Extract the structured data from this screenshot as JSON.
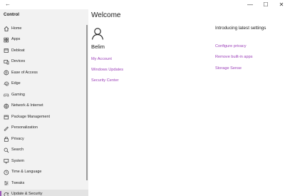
{
  "window": {
    "back_glyph": "←",
    "minimize_glyph": "—",
    "maximize_glyph": "☐",
    "close_glyph": "✕"
  },
  "sidebar": {
    "title": "Control",
    "items": [
      {
        "label": "Home",
        "icon": "home-icon"
      },
      {
        "label": "Apps",
        "icon": "apps-icon"
      },
      {
        "label": "Debloat",
        "icon": "debloat-icon"
      },
      {
        "label": "Devices",
        "icon": "devices-icon"
      },
      {
        "label": "Ease of Access",
        "icon": "ease-of-access-icon"
      },
      {
        "label": "Edge",
        "icon": "edge-icon"
      },
      {
        "label": "Gaming",
        "icon": "gaming-icon"
      },
      {
        "label": "Network & Internet",
        "icon": "network-icon"
      },
      {
        "label": "Package Management",
        "icon": "package-icon"
      },
      {
        "label": "Personalization",
        "icon": "personalization-icon"
      },
      {
        "label": "Privacy",
        "icon": "lock-icon"
      },
      {
        "label": "Search",
        "icon": "search-icon"
      },
      {
        "label": "System",
        "icon": "system-icon"
      },
      {
        "label": "Time & Language",
        "icon": "time-language-icon"
      },
      {
        "label": "Tweaks",
        "icon": "tweaks-icon"
      },
      {
        "label": "Update & Security",
        "icon": "update-icon",
        "selected": true
      }
    ]
  },
  "main": {
    "heading": "Welcome",
    "user": {
      "name": "Belim",
      "avatar_icon": "person-icon"
    },
    "account_links": [
      "My Account",
      "Windows Updates",
      "Security Center"
    ],
    "intro": {
      "title": "Introducing latest settings",
      "links": [
        "Configure privacy",
        "Remove built-in apps",
        "Storage Sense"
      ]
    }
  },
  "colors": {
    "accent": "#9b3fb8",
    "sidebar_bg": "#f2f2f2",
    "selected_bg": "#e3e3e3"
  }
}
